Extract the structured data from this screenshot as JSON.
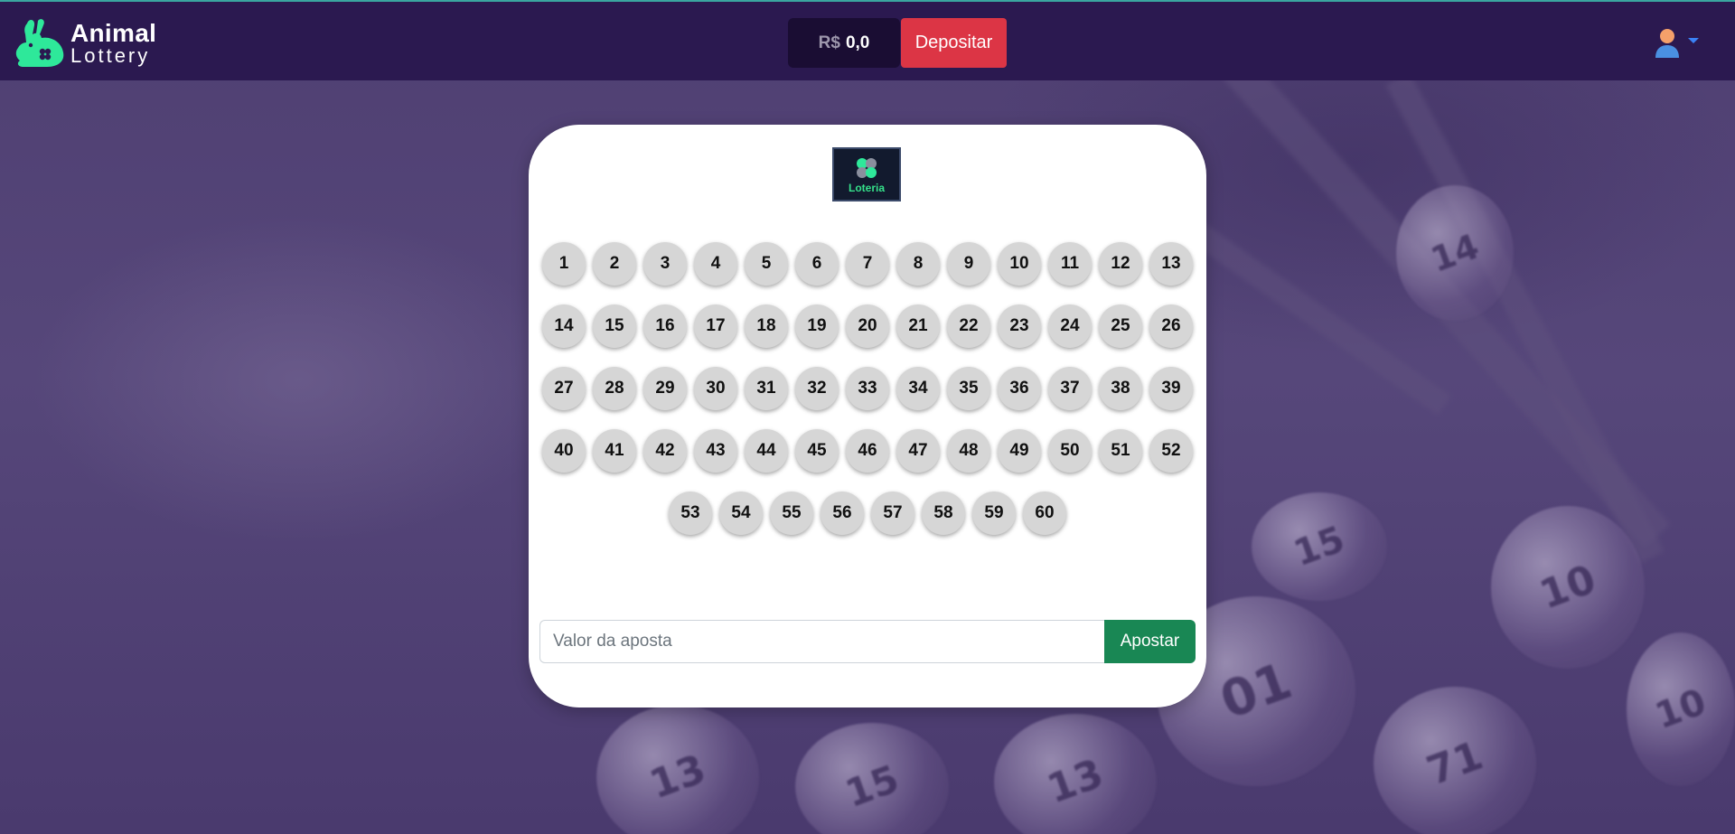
{
  "brand": {
    "line1": "Animal",
    "line2": "Lottery",
    "logo_icon": "rabbit-clover-icon",
    "accent_color": "#2ee89a"
  },
  "header": {
    "balance_currency": "R$",
    "balance_amount": "0,0",
    "deposit_label": "Depositar",
    "user_icon": "user-avatar-icon",
    "background_color": "#2b1950"
  },
  "card": {
    "lottery_logo_text": "Loteria",
    "number_rows": [
      [
        "1",
        "2",
        "3",
        "4",
        "5",
        "6",
        "7",
        "8",
        "9",
        "10",
        "11",
        "12",
        "13"
      ],
      [
        "14",
        "15",
        "16",
        "17",
        "18",
        "19",
        "20",
        "21",
        "22",
        "23",
        "24",
        "25",
        "26"
      ],
      [
        "27",
        "28",
        "29",
        "30",
        "31",
        "32",
        "33",
        "34",
        "35",
        "36",
        "37",
        "38",
        "39"
      ],
      [
        "40",
        "41",
        "42",
        "43",
        "44",
        "45",
        "46",
        "47",
        "48",
        "49",
        "50",
        "51",
        "52"
      ],
      [
        "53",
        "54",
        "55",
        "56",
        "57",
        "58",
        "59",
        "60"
      ]
    ],
    "bet_input": {
      "placeholder": "Valor da aposta",
      "value": ""
    },
    "bet_button_label": "Apostar",
    "bet_button_color": "#198754",
    "deposit_button_color": "#dc3545"
  },
  "background_balls": [
    "14",
    "15",
    "10",
    "13",
    "71",
    "13",
    "01",
    "10",
    "15"
  ]
}
